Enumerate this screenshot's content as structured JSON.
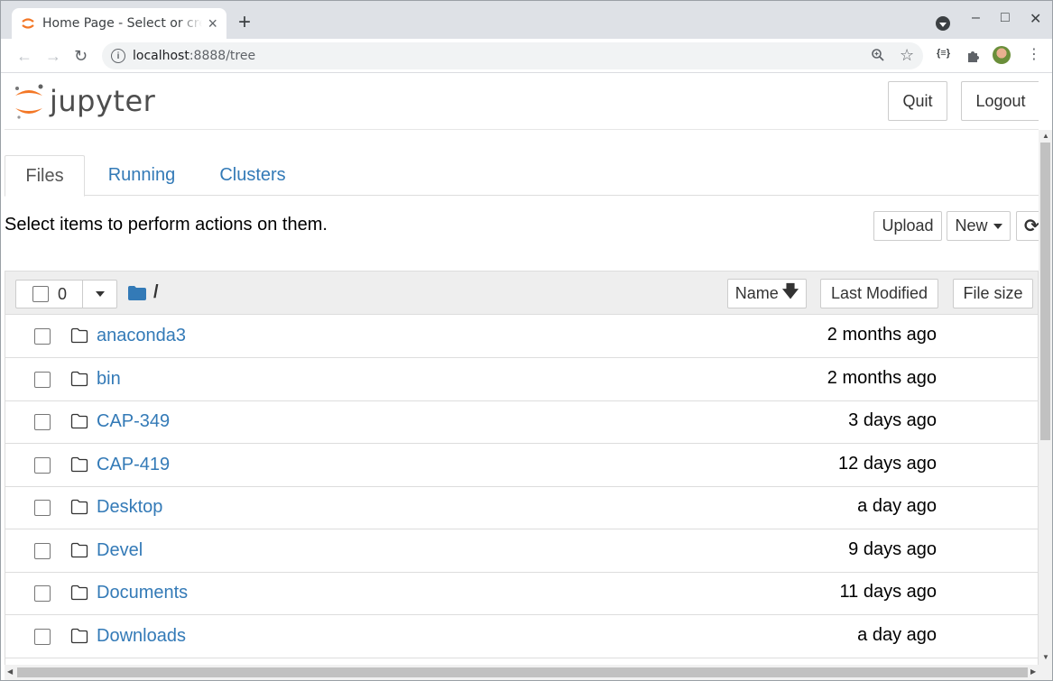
{
  "browser": {
    "tab_title": "Home Page - Select or create a notebook",
    "tab_close": "×",
    "new_tab": "+",
    "url_host": "localhost",
    "url_rest": ":8888/tree",
    "window_controls": {
      "minimize": "–",
      "maximize": "□",
      "close": "✕"
    },
    "nav": {
      "back": "←",
      "forward": "→",
      "reload": "↻"
    }
  },
  "header": {
    "logo_text": "jupyter",
    "quit_label": "Quit",
    "logout_label": "Logout"
  },
  "tabs": [
    {
      "label": "Files",
      "active": true
    },
    {
      "label": "Running",
      "active": false
    },
    {
      "label": "Clusters",
      "active": false
    }
  ],
  "toolbar": {
    "instructions": "Select items to perform actions on them.",
    "upload_label": "Upload",
    "new_label": "New"
  },
  "list_header": {
    "selected_count": "0",
    "breadcrumb": "/",
    "sort_name_label": "Name",
    "sort_modified_label": "Last Modified",
    "sort_size_label": "File size"
  },
  "files": [
    {
      "name": "anaconda3",
      "modified": "2 months ago"
    },
    {
      "name": "bin",
      "modified": "2 months ago"
    },
    {
      "name": "CAP-349",
      "modified": "3 days ago"
    },
    {
      "name": "CAP-419",
      "modified": "12 days ago"
    },
    {
      "name": "Desktop",
      "modified": "a day ago"
    },
    {
      "name": "Devel",
      "modified": "9 days ago"
    },
    {
      "name": "Documents",
      "modified": "11 days ago"
    },
    {
      "name": "Downloads",
      "modified": "a day ago"
    }
  ],
  "colors": {
    "link": "#337ab7",
    "jupyter_orange": "#f37726",
    "header_bg": "#eeeeee"
  }
}
